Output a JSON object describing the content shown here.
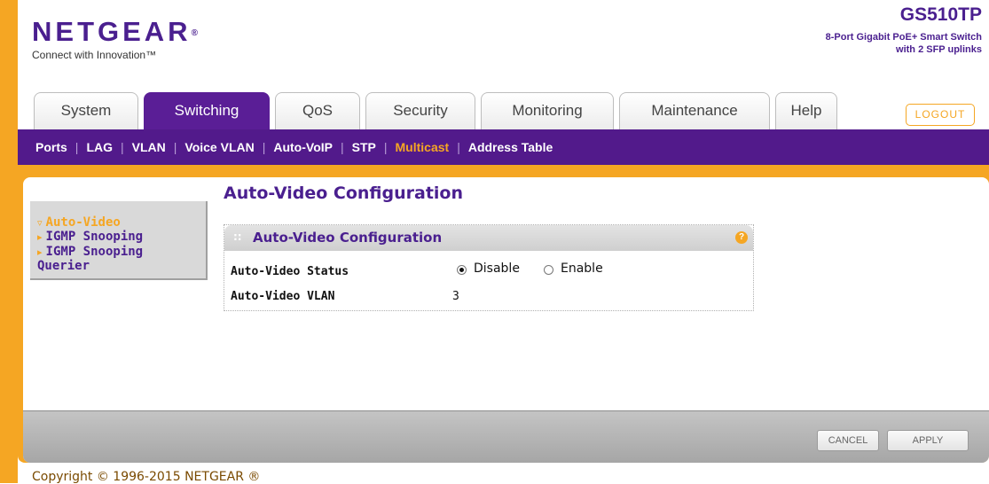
{
  "header": {
    "brand": "NETGEAR",
    "brand_mark": "®",
    "tagline": "Connect with Innovation™",
    "model": "GS510TP",
    "description_line1": "8-Port Gigabit PoE+ Smart Switch",
    "description_line2": "with 2 SFP uplinks",
    "logout_label": "LOGOUT"
  },
  "tabs": [
    {
      "label": "System",
      "active": false
    },
    {
      "label": "Switching",
      "active": true
    },
    {
      "label": "QoS",
      "active": false
    },
    {
      "label": "Security",
      "active": false
    },
    {
      "label": "Monitoring",
      "active": false
    },
    {
      "label": "Maintenance",
      "active": false
    },
    {
      "label": "Help",
      "active": false
    }
  ],
  "subnav": [
    {
      "label": "Ports",
      "active": false
    },
    {
      "label": "LAG",
      "active": false
    },
    {
      "label": "VLAN",
      "active": false
    },
    {
      "label": "Voice VLAN",
      "active": false
    },
    {
      "label": "Auto-VoIP",
      "active": false
    },
    {
      "label": "STP",
      "active": false
    },
    {
      "label": "Multicast",
      "active": true
    },
    {
      "label": "Address Table",
      "active": false
    }
  ],
  "sidebar": {
    "items": [
      {
        "label": "Auto-Video",
        "active": true
      },
      {
        "label": "IGMP Snooping",
        "active": false
      },
      {
        "label": "IGMP Snooping",
        "active": false
      },
      {
        "label": "Querier",
        "active": false
      }
    ]
  },
  "main": {
    "page_title": "Auto-Video Configuration",
    "panel_title": "Auto-Video Configuration",
    "help_icon": "?",
    "status_label": "Auto-Video Status",
    "status_options": [
      {
        "label": "Disable",
        "checked": true
      },
      {
        "label": "Enable",
        "checked": false
      }
    ],
    "vlan_label": "Auto-Video VLAN",
    "vlan_value": "3"
  },
  "buttons": {
    "cancel_label": "CANCEL",
    "apply_label": "APPLY"
  },
  "footer": {
    "copyright": "Copyright © 1996-2015 NETGEAR ®"
  },
  "colors": {
    "brand_purple": "#4a1f8f",
    "nav_purple": "#521a8b",
    "accent_orange": "#f5a623"
  }
}
